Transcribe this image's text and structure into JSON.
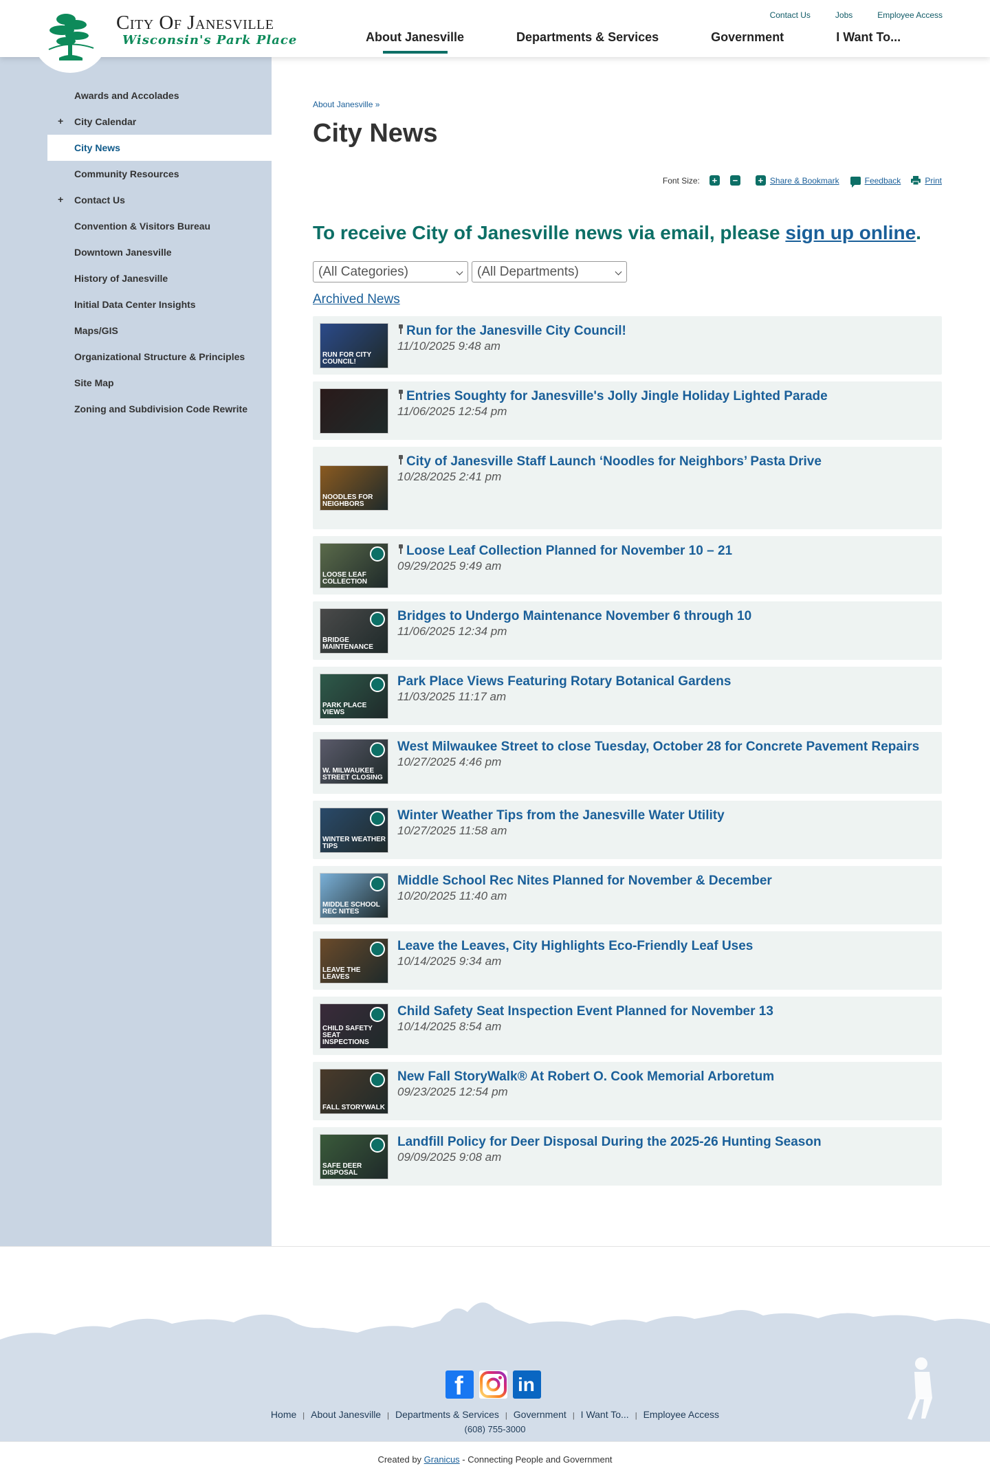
{
  "header": {
    "logo_title": "City Of Janesville",
    "logo_tagline": "Wisconsin's Park Place",
    "utility_links": [
      "Contact Us",
      "Jobs",
      "Employee Access"
    ],
    "main_nav": [
      "About Janesville",
      "Departments & Services",
      "Government",
      "I Want To..."
    ],
    "active_nav": "About Janesville"
  },
  "sidebar": {
    "items": [
      {
        "label": "Awards and Accolades",
        "expandable": false
      },
      {
        "label": "City Calendar",
        "expandable": true
      },
      {
        "label": "City News",
        "expandable": false,
        "active": true
      },
      {
        "label": "Community Resources",
        "expandable": false
      },
      {
        "label": "Contact Us",
        "expandable": true
      },
      {
        "label": "Convention & Visitors Bureau",
        "expandable": false
      },
      {
        "label": "Downtown Janesville",
        "expandable": false
      },
      {
        "label": "History of Janesville",
        "expandable": false
      },
      {
        "label": "Initial Data Center Insights",
        "expandable": false
      },
      {
        "label": "Maps/GIS",
        "expandable": false
      },
      {
        "label": "Organizational Structure & Principles",
        "expandable": false
      },
      {
        "label": "Site Map",
        "expandable": false
      },
      {
        "label": "Zoning and Subdivision Code Rewrite",
        "expandable": false
      }
    ]
  },
  "main": {
    "breadcrumb": "About Janesville »",
    "title": "City News",
    "tools": {
      "font_size_label": "Font Size:",
      "increase": "+",
      "decrease": "−",
      "share_label": "Share & Bookmark",
      "feedback_label": "Feedback",
      "print_label": "Print"
    },
    "signup_text": "To receive City of Janesville news via email, please ",
    "signup_link": "sign up online",
    "signup_end": ".",
    "filters": {
      "category": "(All Categories)",
      "department": "(All Departments)"
    },
    "archived_link": "Archived News",
    "news": [
      {
        "title": "Run for the Janesville City Council!",
        "date": "11/10/2025 9:48 am",
        "pinned": true,
        "thumb_label": "Run for City Council!",
        "thumb_color": "#2b4a8a"
      },
      {
        "title": "Entries Soughty for Janesville's Jolly Jingle Holiday Lighted Parade",
        "date": "11/06/2025 12:54 pm",
        "pinned": true,
        "thumb_label": "",
        "thumb_color": "#2a1a1a"
      },
      {
        "title": "City of Janesville Staff Launch ‘Noodles for Neighbors’ Pasta Drive",
        "date": "10/28/2025 2:41 pm",
        "pinned": true,
        "thumb_label": "Noodles for Neighbors",
        "thumb_color": "#8a5a20"
      },
      {
        "title": "Loose Leaf Collection Planned for November 10 – 21",
        "date": "09/29/2025 9:49 am",
        "pinned": true,
        "thumb_label": "Loose Leaf Collection",
        "thumb_color": "#5a6a4a"
      },
      {
        "title": "Bridges to Undergo Maintenance November 6 through 10",
        "date": "11/06/2025 12:34 pm",
        "pinned": false,
        "thumb_label": "Bridge Maintenance",
        "thumb_color": "#4a4a4a"
      },
      {
        "title": "Park Place Views Featuring Rotary Botanical Gardens",
        "date": "11/03/2025 11:17 am",
        "pinned": false,
        "thumb_label": "Park Place Views",
        "thumb_color": "#2e5a4a"
      },
      {
        "title": "West Milwaukee Street to close Tuesday, October 28 for Concrete Pavement Repairs",
        "date": "10/27/2025 4:46 pm",
        "pinned": false,
        "thumb_label": "W. Milwaukee Street Closing",
        "thumb_color": "#5a5a6a"
      },
      {
        "title": "Winter Weather Tips from the Janesville Water Utility",
        "date": "10/27/2025 11:58 am",
        "pinned": false,
        "thumb_label": "Winter Weather Tips",
        "thumb_color": "#2a4a6a"
      },
      {
        "title": "Middle School Rec Nites Planned for November & December",
        "date": "10/20/2025 11:40 am",
        "pinned": false,
        "thumb_label": "Middle School Rec Nites",
        "thumb_color": "#7ab0d8"
      },
      {
        "title": "Leave the Leaves, City Highlights Eco-Friendly Leaf Uses",
        "date": "10/14/2025 9:34 am",
        "pinned": false,
        "thumb_label": "Leave the Leaves",
        "thumb_color": "#6a4a2a"
      },
      {
        "title": "Child Safety Seat Inspection Event Planned for November 13",
        "date": "10/14/2025 8:54 am",
        "pinned": false,
        "thumb_label": "Child Safety Seat Inspections",
        "thumb_color": "#3a2a3a"
      },
      {
        "title": "New Fall StoryWalk® At Robert O. Cook Memorial Arboretum",
        "date": "09/23/2025 12:54 pm",
        "pinned": false,
        "thumb_label": "Fall StoryWalk",
        "thumb_color": "#4a3a2a"
      },
      {
        "title": "Landfill Policy for Deer Disposal During the 2025-26 Hunting Season",
        "date": "09/09/2025 9:08 am",
        "pinned": false,
        "thumb_label": "Safe Deer Disposal",
        "thumb_color": "#3a5a3a"
      }
    ]
  },
  "footer": {
    "social": [
      "facebook-icon",
      "instagram-icon",
      "linkedin-icon"
    ],
    "links": [
      "Home",
      "About Janesville",
      "Departments & Services",
      "Government",
      "I Want To...",
      "Employee Access"
    ],
    "phone": "(608) 755-3000",
    "credit_prefix": "Created by ",
    "credit_link": "Granicus",
    "credit_suffix": " - Connecting People and Government"
  },
  "colors": {
    "brand_green": "#0d6f66",
    "link_blue": "#1a5f99",
    "sidebar_bg": "#c9d5e3"
  }
}
